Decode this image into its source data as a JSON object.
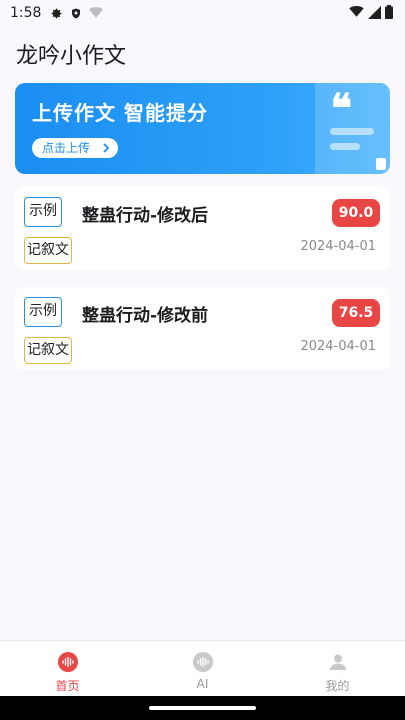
{
  "status_bar": {
    "time": "1:58",
    "icons": [
      "settings-icon",
      "shield-icon",
      "wifi-off-icon",
      "wifi-icon",
      "signal-icon",
      "battery-icon"
    ]
  },
  "app": {
    "title": "龙吟小作文"
  },
  "banner": {
    "headline": "上传作文  智能提分",
    "button_label": "点击上传",
    "quote_glyph": "❝"
  },
  "essays": [
    {
      "tag": "示例",
      "title": "整蛊行动-修改后",
      "genre": "记叙文",
      "score": "90.0",
      "date": "2024-04-01"
    },
    {
      "tag": "示例",
      "title": "整蛊行动-修改前",
      "genre": "记叙文",
      "score": "76.5",
      "date": "2024-04-01"
    }
  ],
  "bottom_nav": {
    "items": [
      {
        "label": "首页",
        "icon": "home-waveform-icon",
        "active": true
      },
      {
        "label": "AI",
        "icon": "ai-waveform-icon",
        "active": false
      },
      {
        "label": "我的",
        "icon": "profile-icon",
        "active": false
      }
    ]
  },
  "colors": {
    "accent_red": "#e84545",
    "banner_blue": "#1a8ff2",
    "tag_blue": "#2b8fe0",
    "tag_gold": "#e0b64a"
  }
}
